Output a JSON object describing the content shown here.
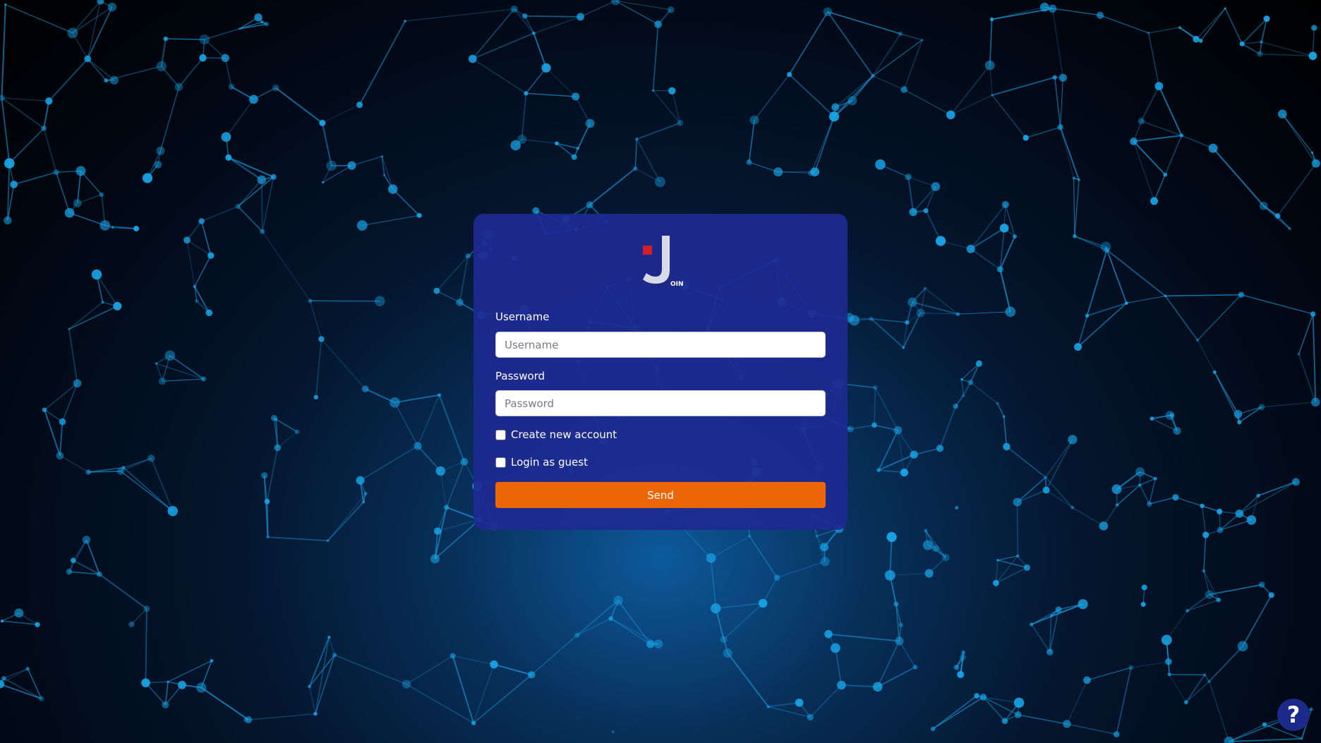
{
  "background": {
    "description_icon": "network-background",
    "primary_color": "#1aa3e8",
    "node_color": "#19a7ea"
  },
  "logo": {
    "letter": "J",
    "suffix": "OIN",
    "accent_color": "#d01f2b"
  },
  "form": {
    "username_label": "Username",
    "username_placeholder": "Username",
    "username_value": "",
    "password_label": "Password",
    "password_placeholder": "Password",
    "password_value": "",
    "create_account_label": "Create new account",
    "create_account_checked": false,
    "guest_label": "Login as guest",
    "guest_checked": false,
    "send_label": "Send"
  },
  "colors": {
    "card": "#1e2a91",
    "button": "#ec6608"
  },
  "help": {
    "icon": "question-mark-icon",
    "glyph": "?"
  }
}
